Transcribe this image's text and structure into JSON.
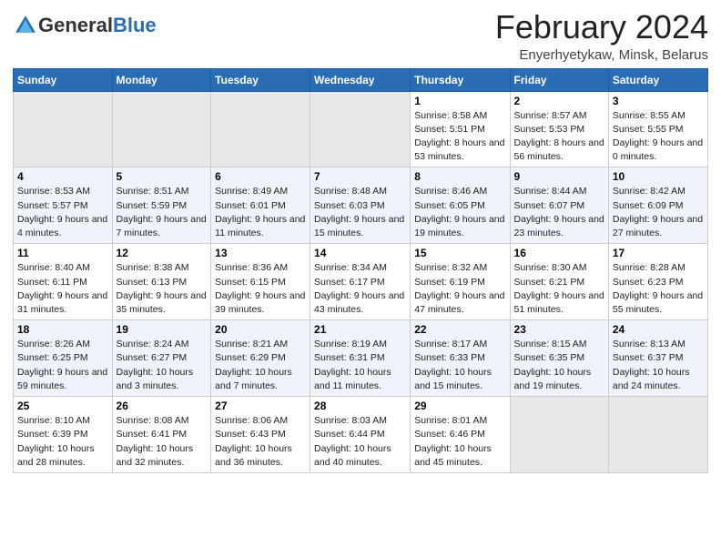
{
  "logo": {
    "general": "General",
    "blue": "Blue"
  },
  "header": {
    "title": "February 2024",
    "subtitle": "Enyerhyetykaw, Minsk, Belarus"
  },
  "weekdays": [
    "Sunday",
    "Monday",
    "Tuesday",
    "Wednesday",
    "Thursday",
    "Friday",
    "Saturday"
  ],
  "weeks": [
    [
      {
        "day": "",
        "info": ""
      },
      {
        "day": "",
        "info": ""
      },
      {
        "day": "",
        "info": ""
      },
      {
        "day": "",
        "info": ""
      },
      {
        "day": "1",
        "info": "Sunrise: 8:58 AM\nSunset: 5:51 PM\nDaylight: 8 hours and 53 minutes."
      },
      {
        "day": "2",
        "info": "Sunrise: 8:57 AM\nSunset: 5:53 PM\nDaylight: 8 hours and 56 minutes."
      },
      {
        "day": "3",
        "info": "Sunrise: 8:55 AM\nSunset: 5:55 PM\nDaylight: 9 hours and 0 minutes."
      }
    ],
    [
      {
        "day": "4",
        "info": "Sunrise: 8:53 AM\nSunset: 5:57 PM\nDaylight: 9 hours and 4 minutes."
      },
      {
        "day": "5",
        "info": "Sunrise: 8:51 AM\nSunset: 5:59 PM\nDaylight: 9 hours and 7 minutes."
      },
      {
        "day": "6",
        "info": "Sunrise: 8:49 AM\nSunset: 6:01 PM\nDaylight: 9 hours and 11 minutes."
      },
      {
        "day": "7",
        "info": "Sunrise: 8:48 AM\nSunset: 6:03 PM\nDaylight: 9 hours and 15 minutes."
      },
      {
        "day": "8",
        "info": "Sunrise: 8:46 AM\nSunset: 6:05 PM\nDaylight: 9 hours and 19 minutes."
      },
      {
        "day": "9",
        "info": "Sunrise: 8:44 AM\nSunset: 6:07 PM\nDaylight: 9 hours and 23 minutes."
      },
      {
        "day": "10",
        "info": "Sunrise: 8:42 AM\nSunset: 6:09 PM\nDaylight: 9 hours and 27 minutes."
      }
    ],
    [
      {
        "day": "11",
        "info": "Sunrise: 8:40 AM\nSunset: 6:11 PM\nDaylight: 9 hours and 31 minutes."
      },
      {
        "day": "12",
        "info": "Sunrise: 8:38 AM\nSunset: 6:13 PM\nDaylight: 9 hours and 35 minutes."
      },
      {
        "day": "13",
        "info": "Sunrise: 8:36 AM\nSunset: 6:15 PM\nDaylight: 9 hours and 39 minutes."
      },
      {
        "day": "14",
        "info": "Sunrise: 8:34 AM\nSunset: 6:17 PM\nDaylight: 9 hours and 43 minutes."
      },
      {
        "day": "15",
        "info": "Sunrise: 8:32 AM\nSunset: 6:19 PM\nDaylight: 9 hours and 47 minutes."
      },
      {
        "day": "16",
        "info": "Sunrise: 8:30 AM\nSunset: 6:21 PM\nDaylight: 9 hours and 51 minutes."
      },
      {
        "day": "17",
        "info": "Sunrise: 8:28 AM\nSunset: 6:23 PM\nDaylight: 9 hours and 55 minutes."
      }
    ],
    [
      {
        "day": "18",
        "info": "Sunrise: 8:26 AM\nSunset: 6:25 PM\nDaylight: 9 hours and 59 minutes."
      },
      {
        "day": "19",
        "info": "Sunrise: 8:24 AM\nSunset: 6:27 PM\nDaylight: 10 hours and 3 minutes."
      },
      {
        "day": "20",
        "info": "Sunrise: 8:21 AM\nSunset: 6:29 PM\nDaylight: 10 hours and 7 minutes."
      },
      {
        "day": "21",
        "info": "Sunrise: 8:19 AM\nSunset: 6:31 PM\nDaylight: 10 hours and 11 minutes."
      },
      {
        "day": "22",
        "info": "Sunrise: 8:17 AM\nSunset: 6:33 PM\nDaylight: 10 hours and 15 minutes."
      },
      {
        "day": "23",
        "info": "Sunrise: 8:15 AM\nSunset: 6:35 PM\nDaylight: 10 hours and 19 minutes."
      },
      {
        "day": "24",
        "info": "Sunrise: 8:13 AM\nSunset: 6:37 PM\nDaylight: 10 hours and 24 minutes."
      }
    ],
    [
      {
        "day": "25",
        "info": "Sunrise: 8:10 AM\nSunset: 6:39 PM\nDaylight: 10 hours and 28 minutes."
      },
      {
        "day": "26",
        "info": "Sunrise: 8:08 AM\nSunset: 6:41 PM\nDaylight: 10 hours and 32 minutes."
      },
      {
        "day": "27",
        "info": "Sunrise: 8:06 AM\nSunset: 6:43 PM\nDaylight: 10 hours and 36 minutes."
      },
      {
        "day": "28",
        "info": "Sunrise: 8:03 AM\nSunset: 6:44 PM\nDaylight: 10 hours and 40 minutes."
      },
      {
        "day": "29",
        "info": "Sunrise: 8:01 AM\nSunset: 6:46 PM\nDaylight: 10 hours and 45 minutes."
      },
      {
        "day": "",
        "info": ""
      },
      {
        "day": "",
        "info": ""
      }
    ]
  ]
}
